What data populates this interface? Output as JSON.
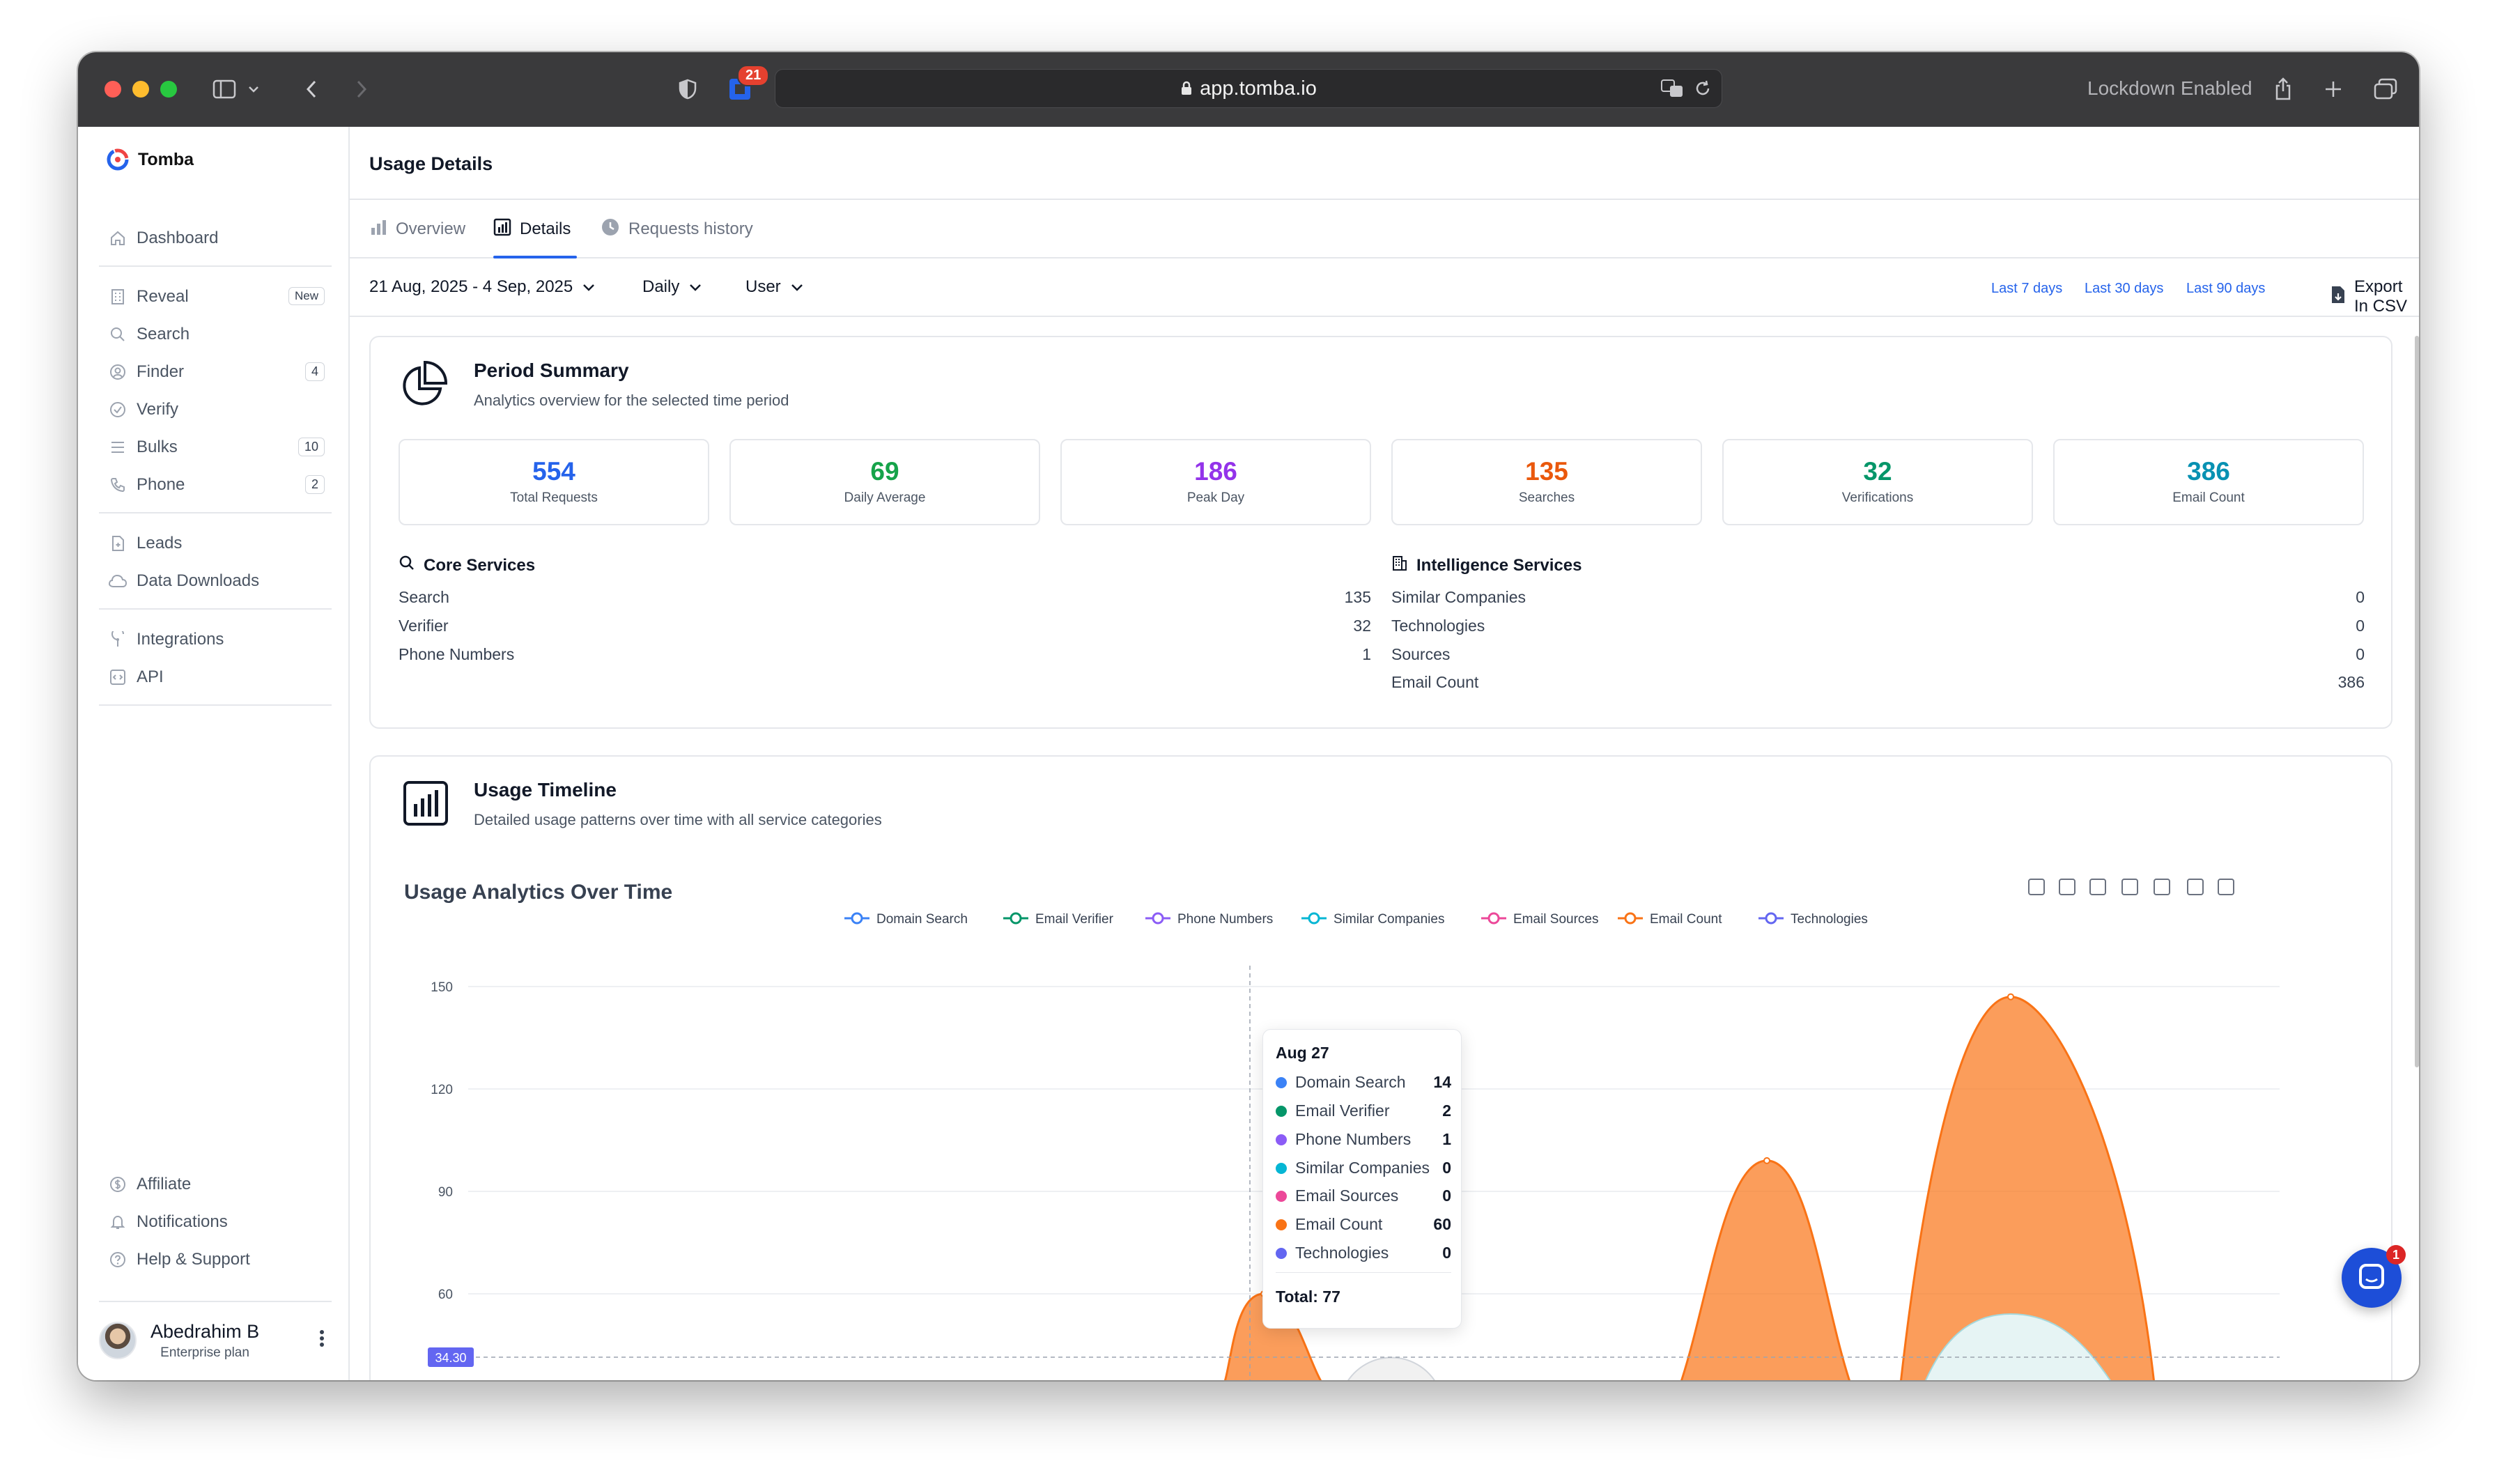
{
  "browser": {
    "url": "app.tomba.io",
    "badge": "21",
    "status": "Lockdown Enabled"
  },
  "sidebar": {
    "brand": "Tomba",
    "items": [
      {
        "label": "Dashboard",
        "icon": "home-icon"
      },
      {
        "label": "Reveal",
        "icon": "building-icon",
        "tag": "New"
      },
      {
        "label": "Search",
        "icon": "search-icon"
      },
      {
        "label": "Finder",
        "icon": "user-circle-icon",
        "count": "4"
      },
      {
        "label": "Verify",
        "icon": "check-circle-icon"
      },
      {
        "label": "Bulks",
        "icon": "list-icon",
        "count": "10"
      },
      {
        "label": "Phone",
        "icon": "phone-icon",
        "count": "2"
      },
      {
        "label": "Leads",
        "icon": "file-plus-icon"
      },
      {
        "label": "Data Downloads",
        "icon": "cloud-icon"
      },
      {
        "label": "Integrations",
        "icon": "plug-icon"
      },
      {
        "label": "API",
        "icon": "code-icon"
      }
    ],
    "bottom": [
      {
        "label": "Affiliate",
        "icon": "dollar-icon"
      },
      {
        "label": "Notifications",
        "icon": "bell-icon"
      },
      {
        "label": "Help & Support",
        "icon": "help-icon"
      }
    ],
    "user": {
      "name": "Abedrahim B",
      "plan": "Enterprise plan"
    }
  },
  "header": {
    "title": "Usage Details"
  },
  "tabs": [
    {
      "label": "Overview",
      "icon": "bar-chart-icon"
    },
    {
      "label": "Details",
      "icon": "chart-icon"
    },
    {
      "label": "Requests history",
      "icon": "clock-icon"
    }
  ],
  "filters": {
    "date_range": "21 Aug, 2025 - 4 Sep, 2025",
    "interval": "Daily",
    "group": "User",
    "quick": [
      "Last 7 days",
      "Last 30 days",
      "Last 90 days"
    ],
    "export": "Export In CSV"
  },
  "summary": {
    "title": "Period Summary",
    "subtitle": "Analytics overview for the selected time period",
    "stats": [
      {
        "value": "554",
        "label": "Total Requests",
        "color": "#2563eb"
      },
      {
        "value": "69",
        "label": "Daily Average",
        "color": "#16a34a"
      },
      {
        "value": "186",
        "label": "Peak Day",
        "color": "#9333ea"
      },
      {
        "value": "135",
        "label": "Searches",
        "color": "#ea580c"
      },
      {
        "value": "32",
        "label": "Verifications",
        "color": "#059669"
      },
      {
        "value": "386",
        "label": "Email Count",
        "color": "#0891b2"
      }
    ],
    "core": {
      "title": "Core Services",
      "rows": [
        {
          "label": "Search",
          "value": "135"
        },
        {
          "label": "Verifier",
          "value": "32"
        },
        {
          "label": "Phone Numbers",
          "value": "1"
        }
      ]
    },
    "intel": {
      "title": "Intelligence Services",
      "rows": [
        {
          "label": "Similar Companies",
          "value": "0"
        },
        {
          "label": "Technologies",
          "value": "0"
        },
        {
          "label": "Sources",
          "value": "0"
        },
        {
          "label": "Email Count",
          "value": "386"
        }
      ]
    }
  },
  "timeline": {
    "title": "Usage Timeline",
    "subtitle": "Detailed usage patterns over time with all service categories",
    "chart_title": "Usage Analytics Over Time"
  },
  "tooltip": {
    "date": "Aug 27",
    "rows": [
      {
        "label": "Domain Search",
        "value": "14",
        "color": "#3b82f6"
      },
      {
        "label": "Email Verifier",
        "value": "2",
        "color": "#059669"
      },
      {
        "label": "Phone Numbers",
        "value": "1",
        "color": "#8b5cf6"
      },
      {
        "label": "Similar Companies",
        "value": "0",
        "color": "#06b6d4"
      },
      {
        "label": "Email Sources",
        "value": "0",
        "color": "#ec4899"
      },
      {
        "label": "Email Count",
        "value": "60",
        "color": "#f97316"
      },
      {
        "label": "Technologies",
        "value": "0",
        "color": "#6366f1"
      }
    ],
    "total": "Total: 77"
  },
  "chat_badge": "1",
  "chart_data": {
    "type": "area",
    "title": "Usage Analytics Over Time",
    "ylim": [
      30,
      150
    ],
    "yticks": [
      "150",
      "120",
      "90",
      "60"
    ],
    "pointer_label": "34.30",
    "grid": true,
    "legend_position": "top-center",
    "series": [
      {
        "name": "Domain Search",
        "color": "#3b82f6"
      },
      {
        "name": "Email Verifier",
        "color": "#059669"
      },
      {
        "name": "Phone Numbers",
        "color": "#8b5cf6"
      },
      {
        "name": "Similar Companies",
        "color": "#06b6d4"
      },
      {
        "name": "Email Sources",
        "color": "#ec4899"
      },
      {
        "name": "Email Count",
        "color": "#f97316"
      },
      {
        "name": "Technologies",
        "color": "#6366f1"
      }
    ],
    "email_count_peaks": [
      {
        "x": "Aug 27",
        "y": 60
      },
      {
        "x": "",
        "y": 99
      },
      {
        "x": "",
        "y": 147
      }
    ]
  }
}
